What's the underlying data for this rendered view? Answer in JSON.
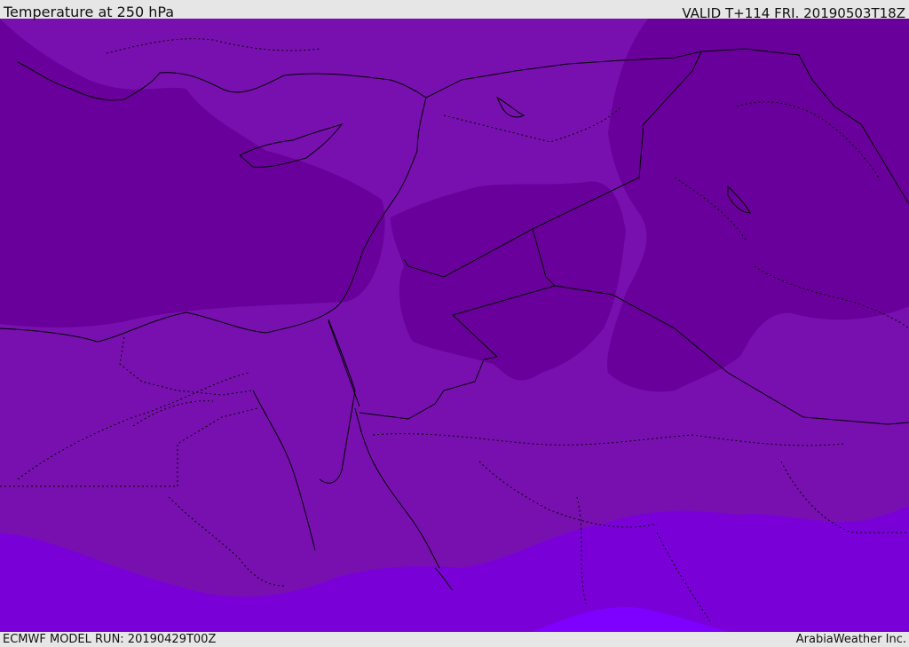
{
  "header": {
    "title": "Temperature at 250 hPa",
    "valid_time": "VALID T+114 FRI. 20190503T18Z"
  },
  "footer": {
    "model_run": "ECMWF MODEL RUN: 20190429T00Z",
    "credit": "ArabiaWeather Inc."
  },
  "map": {
    "field": "temperature-250hPa",
    "colors": {
      "coldest": "#6a009b",
      "mid": "#7810b0",
      "warm": "#7a00d8",
      "warmest": "#7e00ff",
      "border_line": "#000000"
    }
  }
}
